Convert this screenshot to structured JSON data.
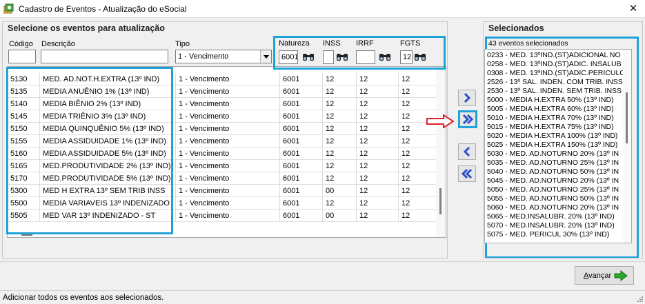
{
  "window": {
    "title": "Cadastro de Eventos - Atualização do eSocial"
  },
  "left": {
    "heading": "Selecione os eventos para atualização",
    "filters": {
      "codigo_label": "Código",
      "codigo_value": "",
      "descricao_label": "Descrição",
      "descricao_value": "",
      "tipo_label": "Tipo",
      "tipo_value": "1 - Vencimento",
      "natureza_label": "Natureza",
      "natureza_value": "6001",
      "inss_label": "INSS",
      "inss_value": "",
      "irrf_label": "IRRF",
      "irrf_value": "",
      "fgts_label": "FGTS",
      "fgts_value": "12"
    },
    "rows": [
      {
        "codigo": "5130",
        "descricao": "MED. AD.NOT.H.EXTRA (13º IND)",
        "tipo": "1 - Vencimento",
        "natureza": "6001",
        "inss": "12",
        "irrf": "12",
        "fgts": "12"
      },
      {
        "codigo": "5135",
        "descricao": "MEDIA ANUÊNIO 1% (13º IND)",
        "tipo": "1 - Vencimento",
        "natureza": "6001",
        "inss": "12",
        "irrf": "12",
        "fgts": "12"
      },
      {
        "codigo": "5140",
        "descricao": "MEDIA BIÊNIO 2% (13º IND)",
        "tipo": "1 - Vencimento",
        "natureza": "6001",
        "inss": "12",
        "irrf": "12",
        "fgts": "12"
      },
      {
        "codigo": "5145",
        "descricao": "MEDIA TRIÊNIO 3% (13º IND)",
        "tipo": "1 - Vencimento",
        "natureza": "6001",
        "inss": "12",
        "irrf": "12",
        "fgts": "12"
      },
      {
        "codigo": "5150",
        "descricao": "MEDIA QUINQUÊNIO 5% (13º IND)",
        "tipo": "1 - Vencimento",
        "natureza": "6001",
        "inss": "12",
        "irrf": "12",
        "fgts": "12"
      },
      {
        "codigo": "5155",
        "descricao": "MEDIA ASSIDUIDADE 1% (13º IND)",
        "tipo": "1 - Vencimento",
        "natureza": "6001",
        "inss": "12",
        "irrf": "12",
        "fgts": "12"
      },
      {
        "codigo": "5160",
        "descricao": "MEDIA ASSIDUIDADE 5% (13º IND)",
        "tipo": "1 - Vencimento",
        "natureza": "6001",
        "inss": "12",
        "irrf": "12",
        "fgts": "12"
      },
      {
        "codigo": "5165",
        "descricao": "MED.PRODUTIVIDADE 2% (13º IND)",
        "tipo": "1 - Vencimento",
        "natureza": "6001",
        "inss": "12",
        "irrf": "12",
        "fgts": "12"
      },
      {
        "codigo": "5170",
        "descricao": "MED.PRODUTIVIDADE 5% (13º IND)",
        "tipo": "1 - Vencimento",
        "natureza": "6001",
        "inss": "12",
        "irrf": "12",
        "fgts": "12"
      },
      {
        "codigo": "5300",
        "descricao": "MED H EXTRA 13º SEM TRIB INSS",
        "tipo": "1 - Vencimento",
        "natureza": "6001",
        "inss": "00",
        "irrf": "12",
        "fgts": "12"
      },
      {
        "codigo": "5500",
        "descricao": "MEDIA VARIAVEIS 13º INDENIZADO",
        "tipo": "1 - Vencimento",
        "natureza": "6001",
        "inss": "12",
        "irrf": "12",
        "fgts": "12"
      },
      {
        "codigo": "5505",
        "descricao": "MED VAR 13º INDENIZADO - ST",
        "tipo": "1 - Vencimento",
        "natureza": "6001",
        "inss": "00",
        "irrf": "12",
        "fgts": "12"
      }
    ]
  },
  "right": {
    "heading": "Selecionados",
    "count_label": "43 eventos selecionados",
    "items": [
      "0233 - MED. 13ºIND.(ST)ADICIONAL NO",
      "0258 - MED. 13ºIND.(ST)ADIC. INSALUB",
      "0308 - MED. 13ºIND.(ST)ADIC.PERICULO",
      "2526 - 13º SAL. INDEN. COM TRIB. INSS",
      "2530 - 13º SAL. INDEN. SEM TRIB. INSS",
      "5000 - MEDIA H.EXTRA 50% (13º IND)",
      "5005 - MEDIA H.EXTRA 60% (13º IND)",
      "5010 - MEDIA H.EXTRA 70% (13º IND)",
      "5015 - MEDIA H.EXTRA 75% (13º IND)",
      "5020 - MEDIA H.EXTRA 100% (13º IND)",
      "5025 - MEDIA H.EXTRA 150% (13º IND)",
      "5030 - MED. AD.NOTURNO 20% (13º IN",
      "5035 - MED. AD.NOTURNO 25%  (13º IN",
      "5040 - MED. AD.NOTURNO 50% (13º IN",
      "5045 - MED. AD.NOTURNO 20%  (13º IN",
      "5050 - MED. AD.NOTURNO 25% (13º IN",
      "5055 - MED. AD.NOTURNO 50% (13º IN",
      "5060 - MED. AD.NOTURNO 20% (13º IN",
      "5065 - MED.INSALUBR. 20% (13º IND)",
      "5070 - MED.INSALUBR. 20% (13º IND)",
      "5075 - MED. PERICUL 30% (13º IND)"
    ]
  },
  "buttons": {
    "advance_pre": "",
    "advance_accel": "A",
    "advance_rest": "vançar"
  },
  "status": {
    "text": "Adicionar todos os eventos aos selecionados."
  },
  "colors": {
    "highlight": "#1fa2d8",
    "arrow_blue": "#2a4fc9",
    "red_arrow": "#e0202a",
    "green_arrow": "#2aa82a"
  },
  "icons": [
    "app-icon",
    "close-icon",
    "binoculars-icon",
    "chevron-right-icon",
    "double-chevron-right-icon",
    "chevron-left-icon",
    "double-chevron-left-icon",
    "red-arrow-icon",
    "green-arrow-icon"
  ]
}
